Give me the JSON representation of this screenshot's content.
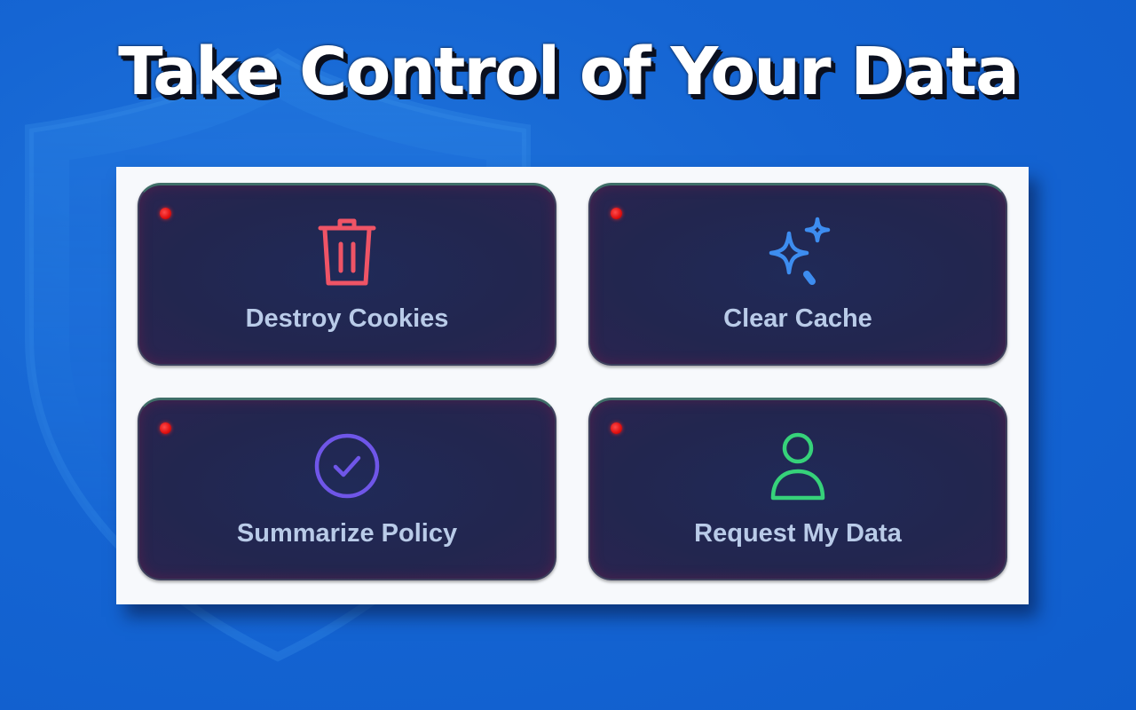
{
  "headline": "Take Control of Your Data",
  "colors": {
    "background": "#1565d3",
    "panel": "#f7f9fc",
    "card": "#22264f",
    "card_label": "#b9cbe8",
    "indicator_dot": "#e01010",
    "trash_icon": "#ef5466",
    "sparkle_icon": "#3d8df0",
    "check_icon": "#6f56e8",
    "user_icon": "#36d27a"
  },
  "actions": [
    {
      "label": "Destroy Cookies",
      "icon": "trash-icon"
    },
    {
      "label": "Clear Cache",
      "icon": "sparkles-icon"
    },
    {
      "label": "Summarize Policy",
      "icon": "check-circle-icon"
    },
    {
      "label": "Request My Data",
      "icon": "user-icon"
    }
  ]
}
